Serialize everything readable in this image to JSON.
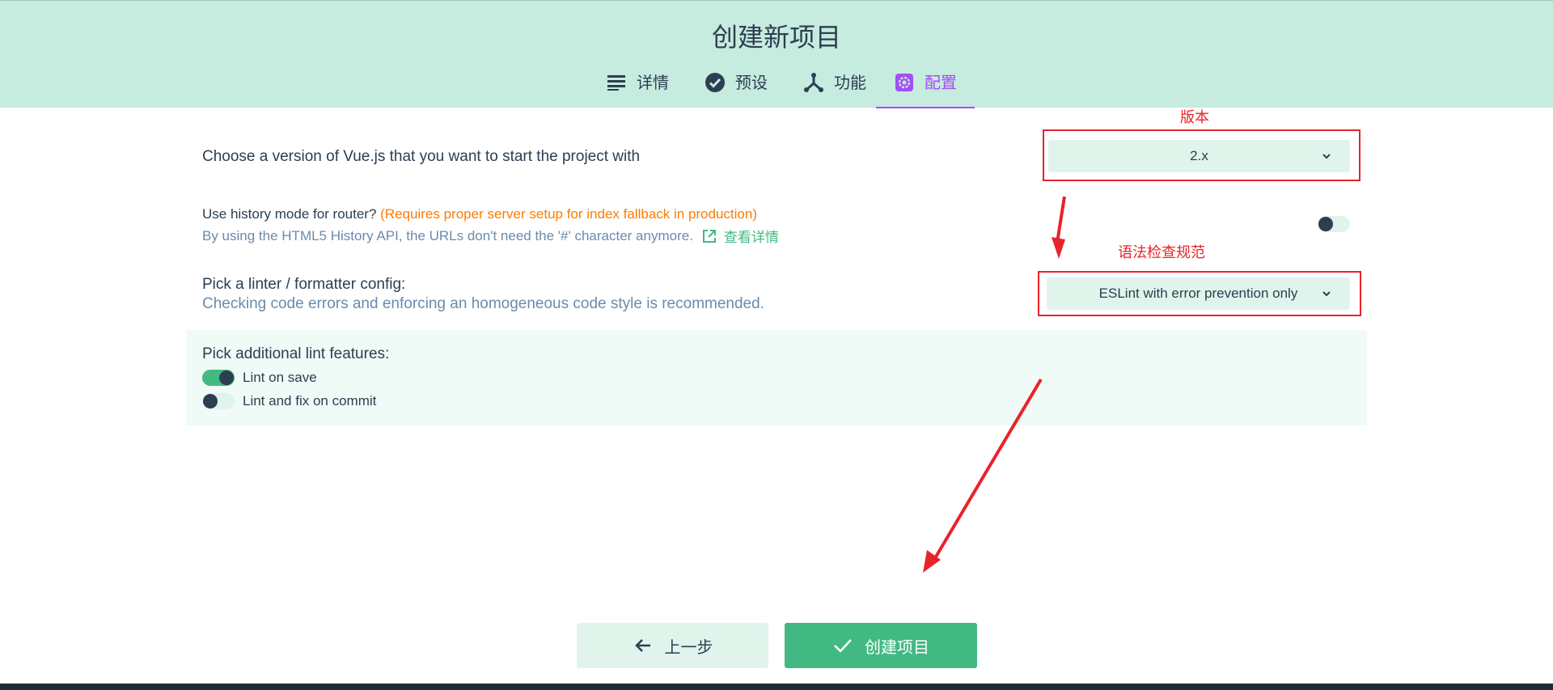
{
  "header": {
    "title": "创建新项目"
  },
  "tabs": [
    {
      "label": "详情",
      "icon": "list-icon"
    },
    {
      "label": "预设",
      "icon": "check-circle-icon"
    },
    {
      "label": "功能",
      "icon": "fork-icon"
    },
    {
      "label": "配置",
      "icon": "gear-icon",
      "active": true
    }
  ],
  "vue_version": {
    "label": "Choose a version of Vue.js that you want to start the project with",
    "selected": "2.x"
  },
  "history_mode": {
    "label": "Use history mode for router?",
    "warning": "(Requires proper server setup for index fallback in production)",
    "description": "By using the HTML5 History API, the URLs don't need the '#' character anymore.",
    "more_link": "查看详情",
    "enabled": false
  },
  "linter": {
    "label": "Pick a linter / formatter config:",
    "description": "Checking code errors and enforcing an homogeneous code style is recommended.",
    "selected": "ESLint with error prevention only"
  },
  "lint_features": {
    "label": "Pick additional lint features:",
    "items": [
      {
        "label": "Lint on save",
        "enabled": true
      },
      {
        "label": "Lint and fix on commit",
        "enabled": false
      }
    ]
  },
  "annotations": {
    "version": "版本",
    "linter": "语法检查规范"
  },
  "footer": {
    "prev_label": "上一步",
    "create_label": "创建项目"
  },
  "colors": {
    "header_bg": "#c6ebdf",
    "accent_green": "#42b983",
    "active_tab": "#a44cf6",
    "warning": "#ff7b00",
    "annotation_red": "#e8232a"
  }
}
